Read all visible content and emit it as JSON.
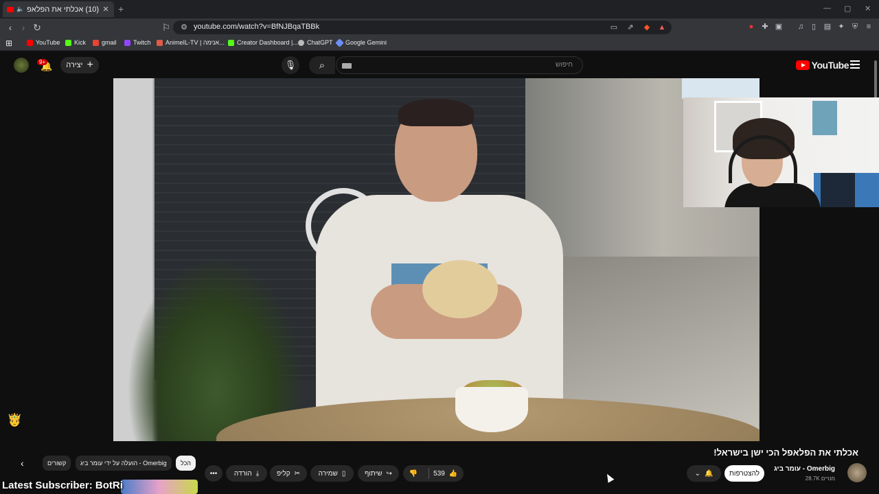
{
  "browser": {
    "tab_title": "(10) אכלתי את הפלאפל הכי",
    "url": "youtube.com/watch?v=BfNJBqaTBBk",
    "bookmarks": [
      {
        "label": "YouTube",
        "color": "#ff0000"
      },
      {
        "label": "Kick",
        "color": "#53fc18"
      },
      {
        "label": "gmail",
        "color": "#ea4335"
      },
      {
        "label": "Twitch",
        "color": "#9146ff"
      },
      {
        "label": "AnimeIL-TV | אנימה...",
        "color": "#e05a47"
      },
      {
        "label": "Creator Dashboard |...",
        "color": "#53fc18"
      },
      {
        "label": "ChatGPT",
        "color": "#bbbbbb"
      },
      {
        "label": "Google Gemini",
        "color": "#6b8df5"
      }
    ]
  },
  "header": {
    "search_placeholder": "חיפוש",
    "create_label": "יצירה",
    "notification_badge": "9+",
    "logo_text": "YouTube",
    "logo_sup": "IL"
  },
  "video": {
    "title": "אכלתי את הפלאפל הכי ישן בישראל!",
    "channel_name": "עומר ביג - Omerbig",
    "channel_subs": "28.7K מנויים",
    "join_label": "להצטרפות",
    "like_count": "539",
    "share_label": "שיתוף",
    "save_label": "שמירה",
    "clip_label": "קליפ",
    "download_label": "הורדה"
  },
  "chips": {
    "all": "הכל",
    "uploaded_by": "הועלה על ידי עומר ביג - Omerbig",
    "related": "קשורים"
  },
  "overlay": {
    "latest_subscriber": "Latest Subscriber: BotRi"
  },
  "colors": {
    "brand": "#ff0000",
    "background": "#0f0f0f"
  }
}
